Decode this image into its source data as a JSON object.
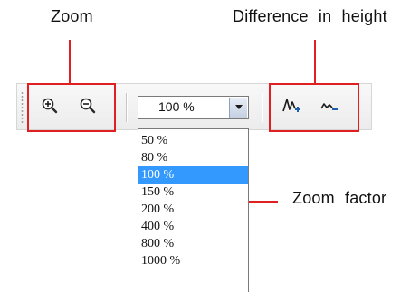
{
  "callouts": {
    "zoom": "Zoom",
    "difference_in_height": "Difference in height",
    "zoom_factor": "Zoom factor"
  },
  "colors": {
    "callout_red": "#e02020",
    "selection_blue": "#3399ff",
    "toolbar_bg": "#ececec"
  },
  "toolbar": {
    "buttons": [
      {
        "name": "zoom-in",
        "icon": "magnifier-plus-icon"
      },
      {
        "name": "zoom-out",
        "icon": "magnifier-minus-icon"
      },
      {
        "name": "height-increase",
        "icon": "profile-plus-icon"
      },
      {
        "name": "height-decrease",
        "icon": "profile-minus-icon"
      }
    ],
    "zoom_combo": {
      "value": "100 %",
      "options": [
        "50 %",
        "80 %",
        "100 %",
        "150 %",
        "200 %",
        "400 %",
        "800 %",
        "1000 %"
      ],
      "selected_index": 2
    }
  }
}
